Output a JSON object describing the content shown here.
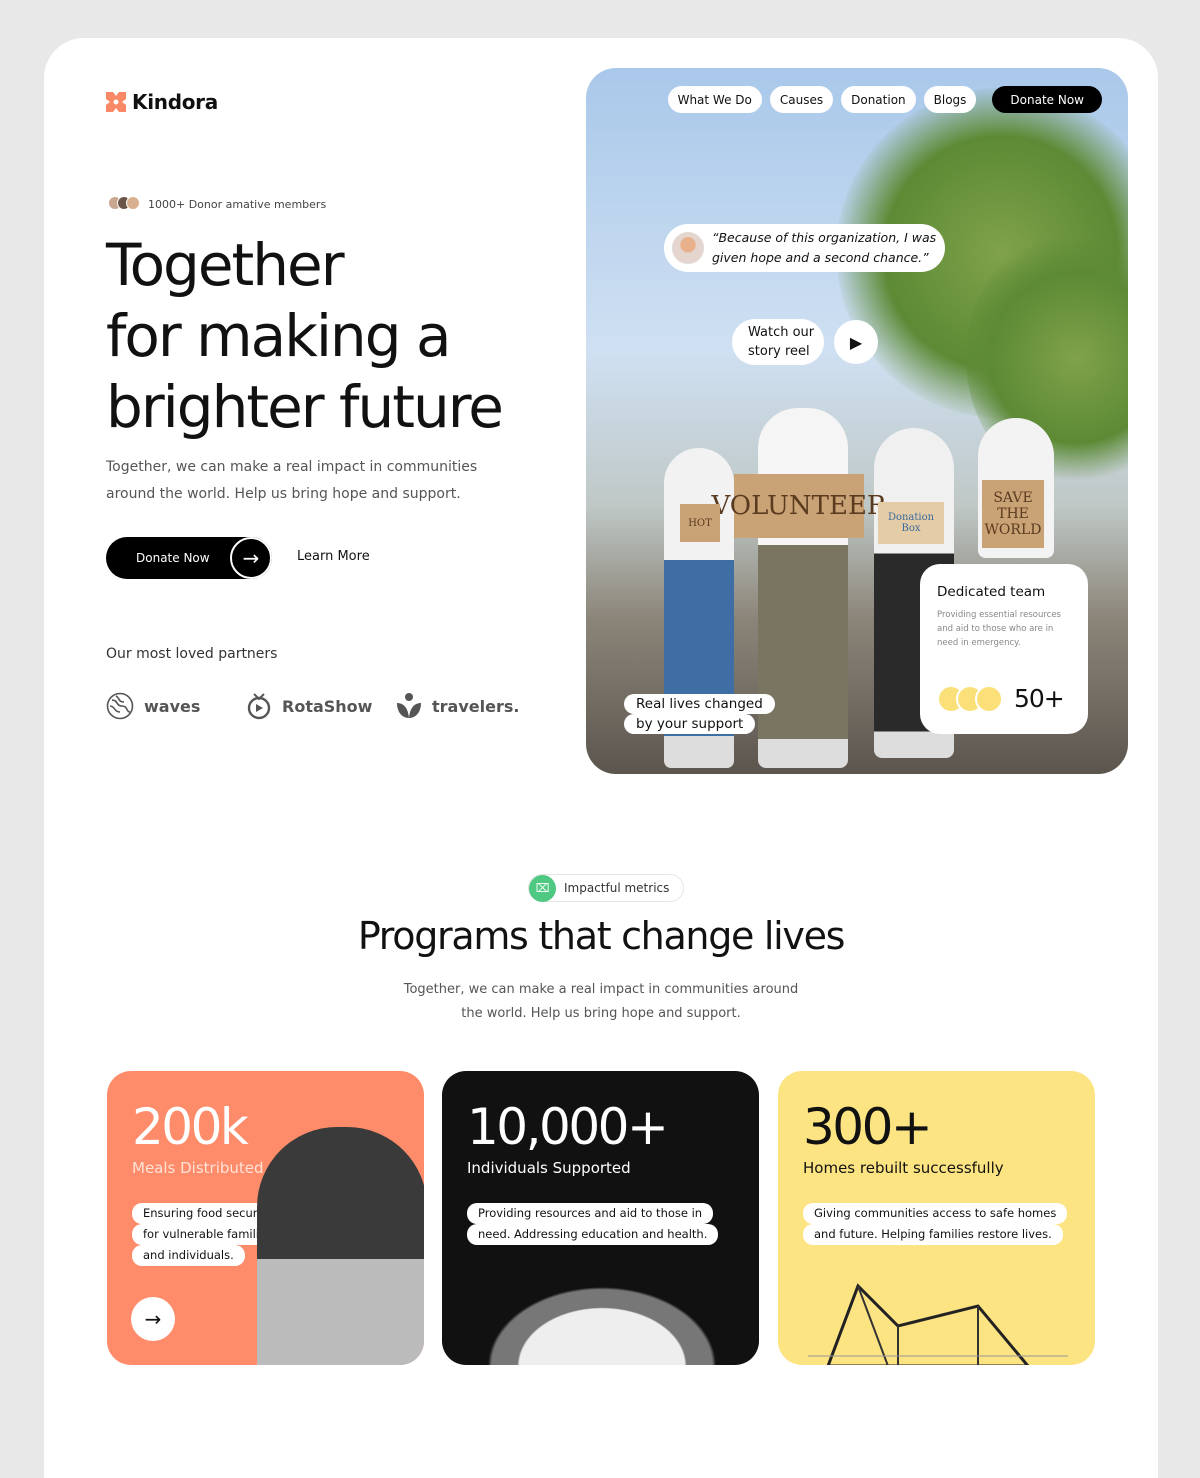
{
  "brand": {
    "name": "Kindora",
    "accent": "#f98866"
  },
  "nav": {
    "items": [
      "What We Do",
      "Causes",
      "Donation",
      "Blogs"
    ],
    "cta": "Donate Now"
  },
  "hero": {
    "members": "1000+ Donor amative members",
    "title": [
      "Together",
      "for making a",
      "brighter future"
    ],
    "subtitle": "Together, we can make a real impact in communities around the world. Help us bring hope and support.",
    "donate_label": "Donate Now",
    "learn_label": "Learn More",
    "partners_heading": "Our most loved partners",
    "partners": [
      "waves",
      "RotaShow",
      "travelers."
    ],
    "quote": "“Because of this organization, I was given hope and a second chance.”",
    "reel": "Watch our story reel",
    "signs": [
      "VOLUNTEER",
      "SAVE THE WORLD",
      "Donation Box",
      "HOT"
    ],
    "team": {
      "title": "Dedicated team",
      "text": "Providing essential resources and aid to those who are in need in emergency.",
      "count": "50+"
    },
    "lives": [
      "Real lives changed",
      "by your support"
    ]
  },
  "metrics": {
    "badge": "Impactful metrics",
    "title": "Programs that change lives",
    "subtitle": "Together, we can make a real impact in communities around the world. Help us bring hope and support.",
    "cards": [
      {
        "value": "200k",
        "label": "Meals Distributed",
        "lines": [
          "Ensuring food security",
          "for vulnerable families",
          "and individuals."
        ],
        "color": "#fe8b69"
      },
      {
        "value": "10,000+",
        "label": "Individuals Supported",
        "lines": [
          "Providing resources and aid to those in",
          "need. Addressing education and health."
        ],
        "color": "#111111"
      },
      {
        "value": "300+",
        "label": "Homes rebuilt successfully",
        "lines": [
          "Giving communities access to safe homes",
          "and future. Helping families restore lives."
        ],
        "color": "#fde482"
      }
    ]
  }
}
